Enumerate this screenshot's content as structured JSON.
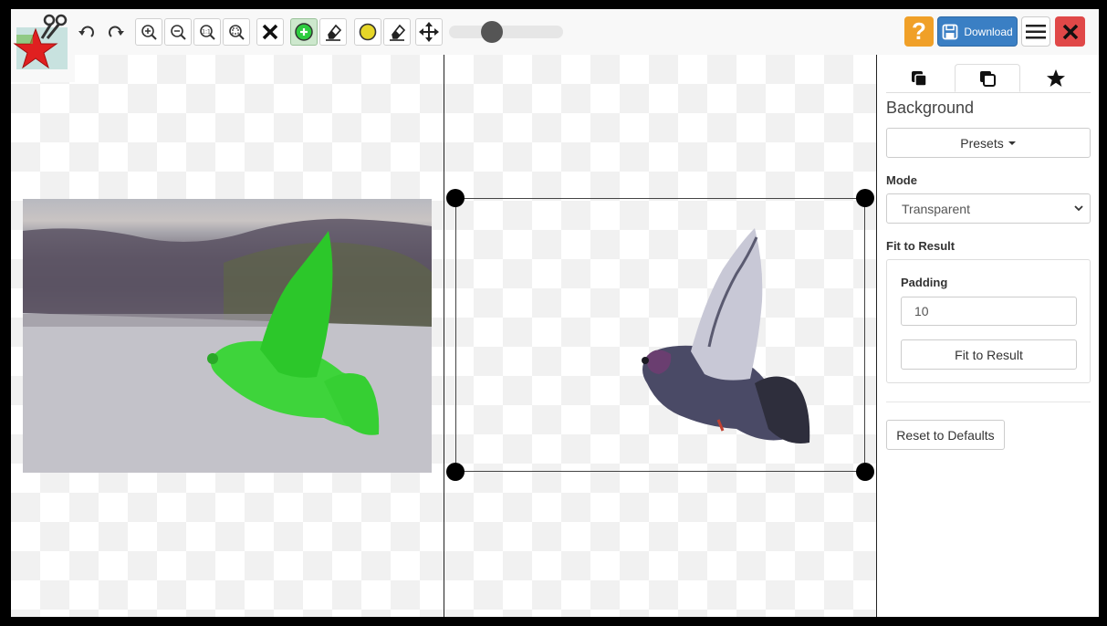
{
  "toolbar": {
    "logo_icon": "clipping-magic-logo-icon",
    "buttons": [
      "undo-icon",
      "redo-icon",
      "zoom-in-icon",
      "zoom-out-icon",
      "zoom-actual-size-icon",
      "zoom-fit-icon",
      "clear-marks-icon",
      "keep-brush-icon",
      "remove-eraser-icon",
      "hair-brush-icon",
      "hair-eraser-icon",
      "pan-icon"
    ],
    "help_label": "?",
    "download_label": "Download",
    "brush_size": 0.35
  },
  "colors": {
    "keep": "#2ecc40",
    "hair": "#e6d628",
    "download": "#3a7fc4",
    "help": "#f0a028",
    "close": "#e04848"
  },
  "sidebar": {
    "tabs": [
      "background-tab-icon",
      "crop-tab-icon",
      "star-tab-icon"
    ],
    "active_tab": 1,
    "heading": "Background",
    "presets_label": "Presets",
    "mode_label": "Mode",
    "mode_value": "Transparent",
    "fit_label": "Fit to Result",
    "padding_label": "Padding",
    "padding_value": "10",
    "fit_button": "Fit to Result",
    "reset_button": "Reset to Defaults"
  }
}
